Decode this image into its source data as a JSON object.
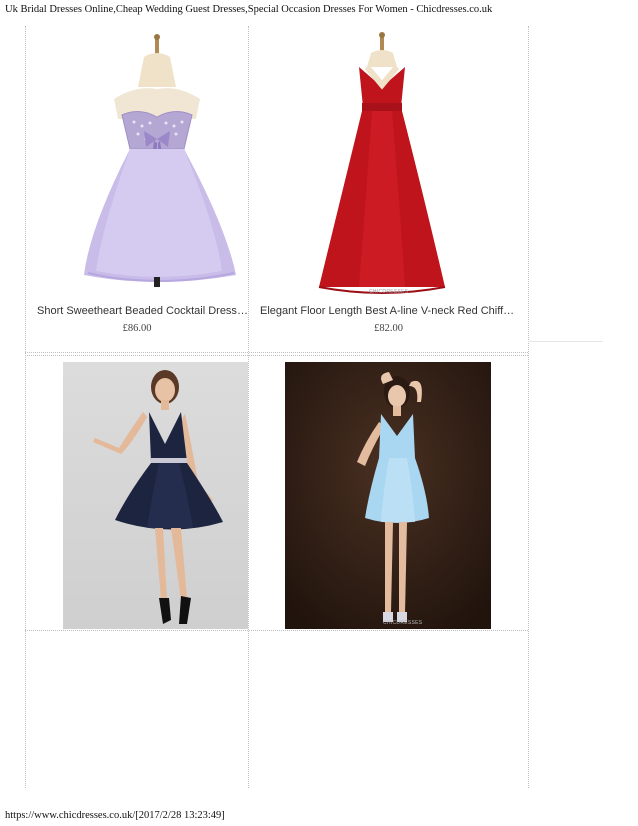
{
  "page": {
    "title": "Uk Bridal Dresses Online,Cheap Wedding Guest Dresses,Special Occasion Dresses For Women - Chicdresses.co.uk",
    "footer_url": "https://www.chicdresses.co.uk/[2017/2/28 13:23:49]"
  },
  "products": [
    {
      "name": "Short Sweetheart Beaded Cocktail Dresses Mini",
      "price": "£86.00",
      "image_icon": "lavender-cocktail-dress-icon",
      "color": "#c9b8e8"
    },
    {
      "name": "Elegant Floor Length Best A-line V-neck Red Chiffon Evening Dresses",
      "price": "£82.00",
      "image_icon": "red-evening-gown-icon",
      "color": "#c0141c",
      "watermark": "CHICDRESSES"
    },
    {
      "name": "",
      "price": "",
      "image_icon": "navy-v-neck-dress-photo",
      "color": "#1d2440"
    },
    {
      "name": "",
      "price": "",
      "image_icon": "light-blue-halter-dress-photo",
      "color": "#a9d6f0",
      "watermark": "CHICDRESSES"
    }
  ]
}
